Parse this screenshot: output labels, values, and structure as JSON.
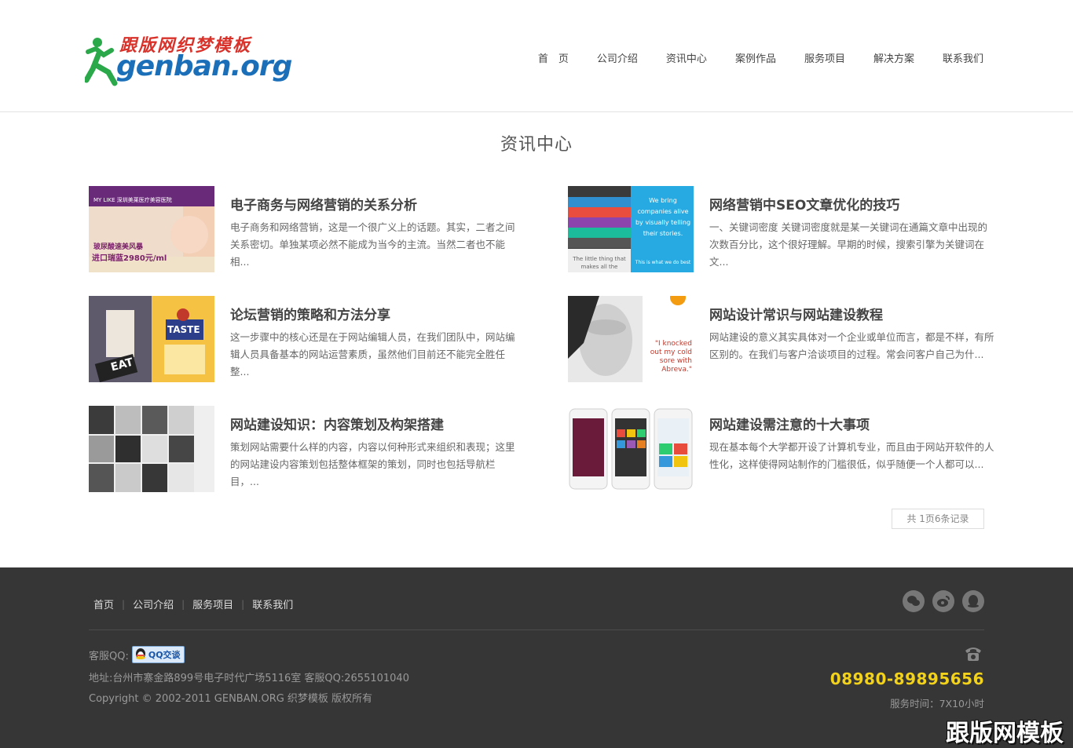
{
  "header": {
    "logo": {
      "cn_text": "跟版网织梦模板",
      "en_text": "genban.org"
    },
    "nav": [
      "首　页",
      "公司介绍",
      "资讯中心",
      "案例作品",
      "服务项目",
      "解决方案",
      "联系我们"
    ]
  },
  "section": {
    "title": "资讯中心"
  },
  "news": [
    {
      "title": "电子商务与网络营销的关系分析",
      "desc": "电子商务和网络营销，这是一个很广义上的话题。其实，二者之间关系密切。单独某项必然不能成为当今的主流。当然二者也不能相...",
      "thumb_texts": [
        "MY LIKE 深圳美莱医疗美容医院",
        "玻尿酸速美风暴",
        "进口瑞蓝2980元/ml"
      ]
    },
    {
      "title": "网络营销中SEO文章优化的技巧",
      "desc": "一、关键词密度 关键词密度就是某一关键词在通篇文章中出现的次数百分比，这个很好理解。早期的时候，搜索引擎为关键词在文...",
      "thumb_texts": [
        "We bring companies alive by visually telling their stories.",
        "The little thing that makes all the",
        "This is what we do best"
      ]
    },
    {
      "title": "论坛营销的策略和方法分享",
      "desc": "这一步骤中的核心还是在于网站编辑人员，在我们团队中，网站编辑人员具备基本的网站运营素质，虽然他们目前还不能完全胜任整...",
      "thumb_texts": [
        "TASTE",
        "EAT"
      ]
    },
    {
      "title": "网站设计常识与网站建设教程",
      "desc": "网站建设的意义其实具体对一个企业或单位而言，都是不样，有所区别的。在我们与客户洽谈项目的过程。常会问客户自己为什...",
      "thumb_texts": [
        "\"I knocked out my cold sore with Abreva.\""
      ]
    },
    {
      "title": "网站建设知识：内容策划及构架搭建",
      "desc": "策划网站需要什么样的内容，内容以何种形式来组织和表现；这里的网站建设内容策划包括整体框架的策划，同时也包括导航栏目，...",
      "thumb_texts": []
    },
    {
      "title": "网站建设需注意的十大事项",
      "desc": "现在基本每个大学都开设了计算机专业，而且由于网站开软件的人性化，这样使得网站制作的门槛很低，似乎随便一个人都可以...",
      "thumb_texts": []
    }
  ],
  "pager": {
    "text": "共 1页6条记录"
  },
  "footer": {
    "nav": [
      "首页",
      "公司介绍",
      "服务项目",
      "联系我们"
    ],
    "social_icons": [
      "wechat-icon",
      "weibo-icon",
      "qq-icon"
    ],
    "kefu_label": "客服QQ:",
    "qq_badge": "QQ交谈",
    "address": "地址:台州市寨金路899号电子时代广场5116室 客服QQ:2655101040",
    "copyright": "Copyright © 2002-2011 GENBAN.ORG 织梦模板 版权所有",
    "phone": "08980-89895656",
    "hours": "服务时间：7X10小时",
    "watermark": "跟版网模板"
  },
  "colors": {
    "phone": "#f2d21b",
    "footer_bg": "#363636",
    "logo_green": "#2aa84a",
    "logo_blue": "#1b6fb8",
    "logo_red": "#d8322b"
  }
}
